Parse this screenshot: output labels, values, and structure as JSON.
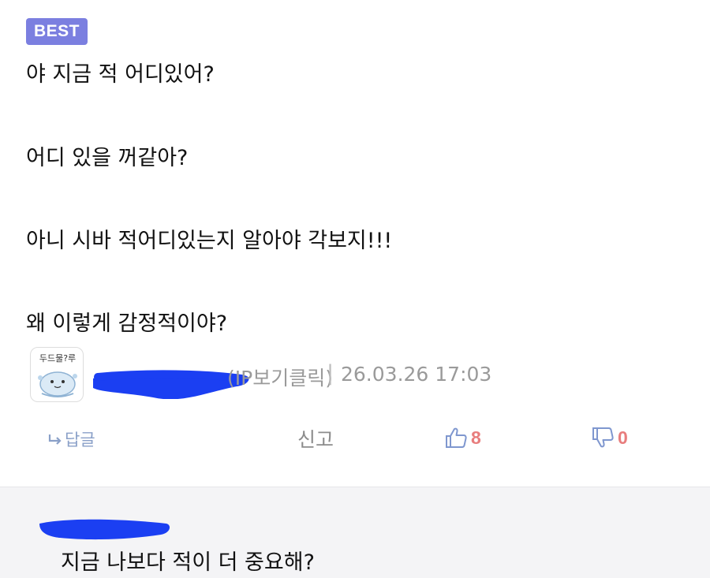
{
  "post": {
    "badge": "BEST",
    "lines": [
      "야 지금 적 어디있어?",
      "어디 있을 꺼같아?",
      "아니 시바 적어디있는지 알아야 각보지!!!",
      "왜 이렇게 감정적이야?"
    ]
  },
  "meta": {
    "avatar_text": "두드물?루",
    "author_tail": "(IP보기클릭)",
    "separator": "|",
    "date": "26.03.26 17:03"
  },
  "actions": {
    "reply_label": "답글",
    "report_label": "신고",
    "like_count": "8",
    "dislike_count": "0"
  },
  "reply": {
    "text": "지금 나보다 적이 더 중요해?"
  },
  "colors": {
    "badge": "#7b7fe0",
    "redaction": "#1b3ff2",
    "count": "#e87d7d",
    "thumb": "#7f97cf"
  }
}
